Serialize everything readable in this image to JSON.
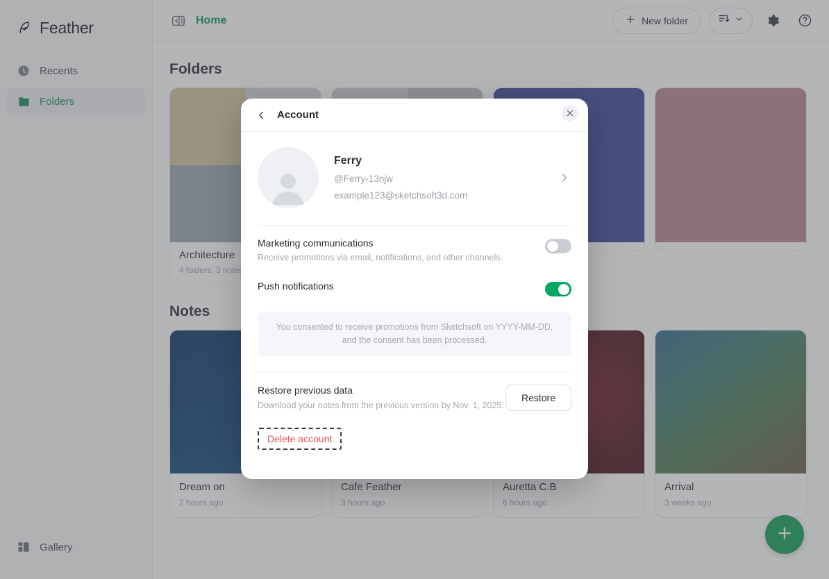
{
  "app": {
    "brand": "Feather",
    "brand_icon": "feather-logo-icon"
  },
  "sidebar": {
    "items": [
      {
        "label": "Recents",
        "icon": "clock-icon",
        "active": false
      },
      {
        "label": "Folders",
        "icon": "folder-icon",
        "active": true
      }
    ],
    "bottom": {
      "label": "Gallery",
      "icon": "gallery-grid-icon"
    }
  },
  "topbar": {
    "panel_toggle_icon": "sidebar-collapse-icon",
    "breadcrumb": "Home",
    "new_folder_label": "New folder",
    "new_folder_icon": "plus-icon",
    "sort_icon": "sort-descending-icon",
    "sort_chevron_icon": "chevron-down-icon",
    "settings_icon": "gear-icon",
    "help_icon": "question-circle-icon"
  },
  "main": {
    "folders_heading": "Folders",
    "notes_heading": "Notes",
    "folders": [
      {
        "name": "Architecture",
        "meta": "4 folders, 3 notes",
        "thumb_colors": [
          "#cfc49c",
          "#c9cacd",
          "#8f9aa6",
          "#d8d8da"
        ]
      },
      {
        "name": "",
        "meta": "",
        "thumb_colors": [
          "#c9cacd",
          "#b9bbc0",
          "#cfd0d4",
          "#d8d8da"
        ]
      },
      {
        "name": "",
        "meta": "",
        "thumb_colors": [
          "#3a4396",
          "#3a4396",
          "#3a4396",
          "#3a4396"
        ]
      },
      {
        "name": "",
        "meta": "",
        "thumb_colors": [
          "#b5868c",
          "#b5868c",
          "#b5868c",
          "#b5868c"
        ]
      }
    ],
    "notes": [
      {
        "name": "Dream on",
        "time": "2 hours ago",
        "thumb_color": "#0c3a6e"
      },
      {
        "name": "Cafe Feather",
        "time": "3 hours ago",
        "thumb_color": "#8e9095"
      },
      {
        "name": "Auretta C.B",
        "time": "6 hours ago",
        "thumb_color": "#5b1620"
      },
      {
        "name": "Arrival",
        "time": "3 weeks ago",
        "thumb_color": "#3f6a78"
      }
    ],
    "fab_icon": "plus-icon"
  },
  "modal": {
    "back_icon": "chevron-left-icon",
    "title": "Account",
    "close_icon": "close-icon",
    "profile": {
      "avatar_icon": "user-avatar-placeholder-icon",
      "name": "Ferry",
      "handle": "@Ferry-13njw",
      "email": "example123@sketchsoft3d.com",
      "chevron_icon": "chevron-right-icon"
    },
    "settings": [
      {
        "label": "Marketing communications",
        "description": "Receive promotions via email, notifications, and other channels.",
        "state": "off"
      },
      {
        "label": "Push notifications",
        "description": "",
        "state": "on"
      }
    ],
    "consent_note": "You consented to receive promotions from Sketchsoft on YYYY-MM-DD, and the consent has been processed.",
    "restore": {
      "label": "Restore previous data",
      "description": "Download your notes from the previous version by Nov. 1, 2025.",
      "button_label": "Restore"
    },
    "delete_label": "Delete account"
  },
  "colors": {
    "accent_green": "#0b8f55",
    "toggle_on": "#00a861",
    "toggle_off": "#c9ccd2",
    "danger_red": "#e8525e",
    "fab_green": "#0f9d58"
  }
}
